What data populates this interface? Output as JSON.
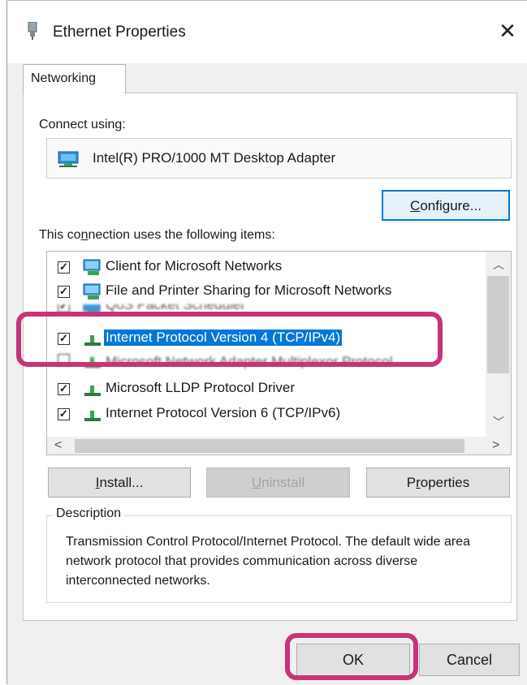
{
  "window": {
    "title": "Ethernet Properties",
    "close_glyph": "✕"
  },
  "tabs": [
    {
      "label": "Networking"
    }
  ],
  "connect_using": {
    "label": "Connect using:",
    "adapter_name": "Intel(R) PRO/1000 MT Desktop Adapter",
    "configure_label_pre": "",
    "configure_label_ul": "C",
    "configure_label_post": "onfigure..."
  },
  "items": {
    "label_pre": "This co",
    "label_ul": "n",
    "label_post": "nection uses the following items:",
    "list": [
      {
        "label": "Client for Microsoft Networks",
        "checked": true,
        "icon": "network-client-icon"
      },
      {
        "label": "File and Printer Sharing for Microsoft Networks",
        "checked": true,
        "icon": "network-share-icon"
      },
      {
        "label": "QoS Packet Scheduler",
        "checked": true,
        "icon": "network-service-icon"
      },
      {
        "label": "Internet Protocol Version 4 (TCP/IPv4)",
        "checked": true,
        "icon": "protocol-icon",
        "selected": true
      },
      {
        "label": "Microsoft Network Adapter Multiplexor Protocol",
        "checked": false,
        "icon": "protocol-icon"
      },
      {
        "label": "Microsoft LLDP Protocol Driver",
        "checked": true,
        "icon": "protocol-icon"
      },
      {
        "label": "Internet Protocol Version 6 (TCP/IPv6)",
        "checked": true,
        "icon": "protocol-icon"
      }
    ]
  },
  "buttons": {
    "install_ul": "I",
    "install_post": "nstall...",
    "uninstall_ul": "U",
    "uninstall_post": "ninstall",
    "properties_pre": "P",
    "properties_ul": "r",
    "properties_post": "operties",
    "ok": "OK",
    "cancel": "Cancel"
  },
  "description": {
    "label": "Description",
    "text": "Transmission Control Protocol/Internet Protocol. The default wide area network protocol that provides communication across diverse interconnected networks."
  },
  "colors": {
    "accent": "#0078d7",
    "highlight": "#c8337a"
  }
}
